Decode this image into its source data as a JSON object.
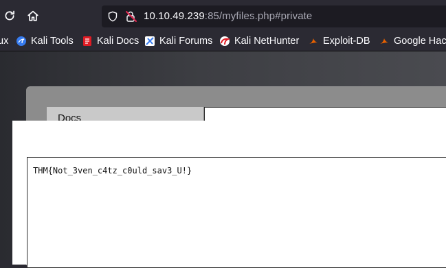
{
  "address_bar": {
    "url_host": "10.10.49.239",
    "url_rest": ":85/myfiles.php#private"
  },
  "bookmarks": [
    {
      "label": "ux",
      "icon": "kali-dragon-icon",
      "color": "#367bf0"
    },
    {
      "label": "Kali Tools",
      "icon": "kali-tools-icon",
      "color": "#367bf0"
    },
    {
      "label": "Kali Docs",
      "icon": "kali-docs-icon",
      "color": "#e01b24"
    },
    {
      "label": "Kali Forums",
      "icon": "kali-forums-icon",
      "color": "#367bf0"
    },
    {
      "label": "Kali NetHunter",
      "icon": "kali-nethunter-icon",
      "color": "#e01b24"
    },
    {
      "label": "Exploit-DB",
      "icon": "exploit-db-icon",
      "color": "#e66000"
    },
    {
      "label": "Google Hack",
      "icon": "ghdb-icon",
      "color": "#e66000"
    }
  ],
  "page": {
    "docs_tab_label": "Docs",
    "flag_text": "THM{Not_3ven_c4tz_c0uld_sav3_U!}"
  },
  "colors": {
    "toolbar_bg": "#2b2a33",
    "urlbar_bg": "#1c1b22",
    "lock_warning": "#e22850"
  }
}
